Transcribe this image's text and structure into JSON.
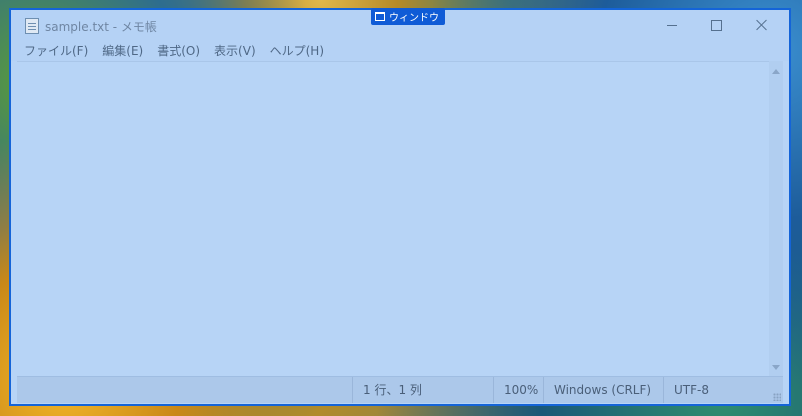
{
  "window": {
    "title": "sample.txt - メモ帳",
    "snap_label": "ウィンドウ",
    "controls": {
      "minimize": "minimize-icon",
      "maximize": "maximize-icon",
      "close": "close-icon"
    }
  },
  "menu": {
    "items": [
      {
        "label": "ファイル(F)"
      },
      {
        "label": "編集(E)"
      },
      {
        "label": "書式(O)"
      },
      {
        "label": "表示(V)"
      },
      {
        "label": "ヘルプ(H)"
      }
    ]
  },
  "editor": {
    "content": ""
  },
  "status": {
    "position": "1 行、1 列",
    "zoom": "100%",
    "line_ending": "Windows (CRLF)",
    "encoding": "UTF-8"
  },
  "colors": {
    "accent": "#1464d8",
    "overlay": "#b7d4f6"
  }
}
